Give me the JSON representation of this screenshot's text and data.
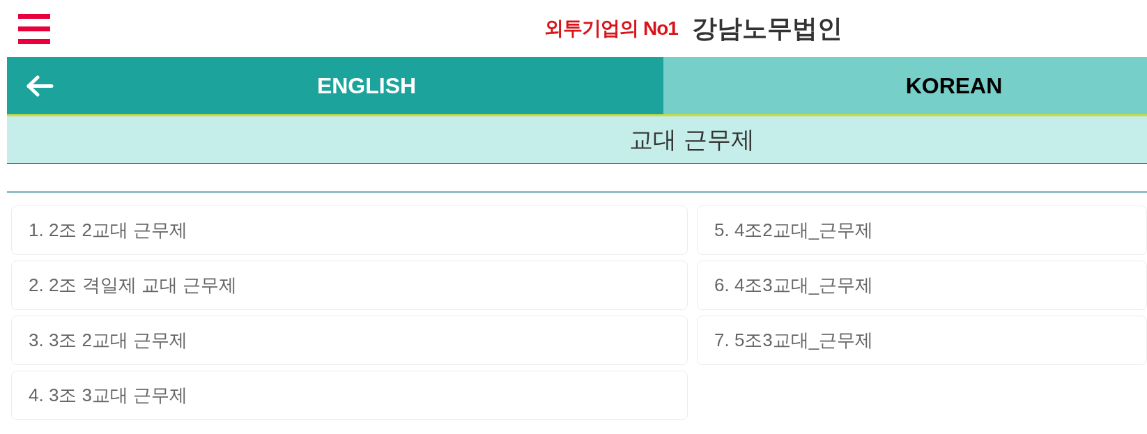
{
  "header": {
    "tagline": "외투기업의 No1",
    "brand": "강남노무법인"
  },
  "tabs": [
    {
      "label": "ENGLISH",
      "selected": true
    },
    {
      "label": "KOREAN",
      "selected": false
    }
  ],
  "section_title": "교대 근무제",
  "items": [
    {
      "label": "1. 2조 2교대 근무제"
    },
    {
      "label": "2. 2조 격일제 교대 근무제"
    },
    {
      "label": "3. 3조 2교대 근무제"
    },
    {
      "label": "4. 3조 3교대 근무제"
    },
    {
      "label": "5. 4조2교대_근무제"
    },
    {
      "label": "6. 4조3교대_근무제"
    },
    {
      "label": "7. 5조3교대_근무제"
    }
  ]
}
